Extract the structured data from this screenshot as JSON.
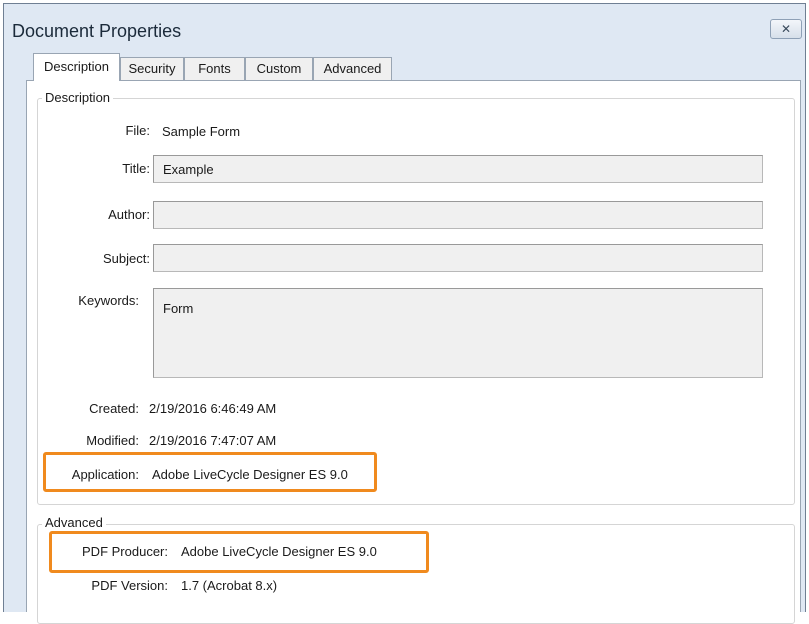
{
  "window": {
    "title": "Document Properties",
    "close_label": "✕"
  },
  "tabs": [
    {
      "label": "Description",
      "active": true
    },
    {
      "label": "Security"
    },
    {
      "label": "Fonts"
    },
    {
      "label": "Custom"
    },
    {
      "label": "Advanced"
    }
  ],
  "description": {
    "legend": "Description",
    "file_label": "File:",
    "file_value": "Sample Form",
    "title_label": "Title:",
    "title_value": "Example",
    "author_label": "Author:",
    "author_value": "",
    "subject_label": "Subject:",
    "subject_value": "",
    "keywords_label": "Keywords:",
    "keywords_value": "Form",
    "created_label": "Created:",
    "created_value": "2/19/2016 6:46:49 AM",
    "modified_label": "Modified:",
    "modified_value": "2/19/2016 7:47:07 AM",
    "application_label": "Application:",
    "application_value": "Adobe LiveCycle Designer ES 9.0"
  },
  "advanced": {
    "legend": "Advanced",
    "producer_label": "PDF Producer:",
    "producer_value": "Adobe LiveCycle Designer ES 9.0",
    "version_label": "PDF Version:",
    "version_value": "1.7 (Acrobat 8.x)"
  },
  "colors": {
    "highlight": "#f08a1e",
    "window_frame": "#dfe8f3"
  }
}
